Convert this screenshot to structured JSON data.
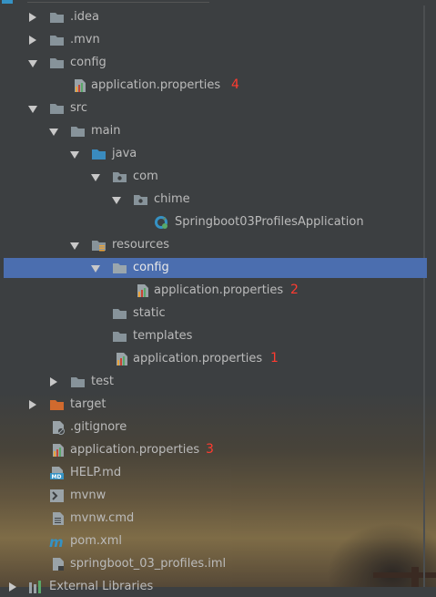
{
  "tree": [
    {
      "label": ".idea",
      "icon": "folder-icon",
      "expanded": false
    },
    {
      "label": ".mvn",
      "icon": "folder-icon",
      "expanded": false
    },
    {
      "label": "config",
      "icon": "folder-icon",
      "expanded": true
    },
    {
      "label": "application.properties",
      "icon": "properties-file-icon",
      "annotation": "4"
    },
    {
      "label": "src",
      "icon": "folder-icon",
      "expanded": true
    },
    {
      "label": "main",
      "icon": "folder-icon",
      "expanded": true
    },
    {
      "label": "java",
      "icon": "source-folder-icon",
      "expanded": true
    },
    {
      "label": "com",
      "icon": "package-icon",
      "expanded": true
    },
    {
      "label": "chime",
      "icon": "package-icon",
      "expanded": true
    },
    {
      "label": "Springboot03ProfilesApplication",
      "icon": "spring-class-icon"
    },
    {
      "label": "resources",
      "icon": "resources-folder-icon",
      "expanded": true
    },
    {
      "label": "config",
      "icon": "folder-icon",
      "expanded": true,
      "selected": true
    },
    {
      "label": "application.properties",
      "icon": "properties-file-icon",
      "annotation": "2"
    },
    {
      "label": "static",
      "icon": "folder-icon"
    },
    {
      "label": "templates",
      "icon": "folder-icon"
    },
    {
      "label": "application.properties",
      "icon": "properties-file-icon",
      "annotation": "1"
    },
    {
      "label": "test",
      "icon": "folder-icon",
      "expanded": false
    },
    {
      "label": "target",
      "icon": "excluded-folder-icon",
      "expanded": false
    },
    {
      "label": ".gitignore",
      "icon": "ignored-file-icon"
    },
    {
      "label": "application.properties",
      "icon": "properties-file-icon",
      "annotation": "3"
    },
    {
      "label": "HELP.md",
      "icon": "markdown-file-icon"
    },
    {
      "label": "mvnw",
      "icon": "shell-file-icon"
    },
    {
      "label": "mvnw.cmd",
      "icon": "text-file-icon"
    },
    {
      "label": "pom.xml",
      "icon": "maven-file-icon"
    },
    {
      "label": "springboot_03_profiles.iml",
      "icon": "iml-file-icon"
    },
    {
      "label": "External Libraries",
      "icon": "libraries-icon",
      "expanded": false
    }
  ],
  "colors": {
    "background": "#3c3f41",
    "selection": "#4b6eaf",
    "annotation": "#ff3b30",
    "folder": "#87939a",
    "source_folder": "#3a8bbf",
    "excluded_folder": "#d06a2e"
  }
}
